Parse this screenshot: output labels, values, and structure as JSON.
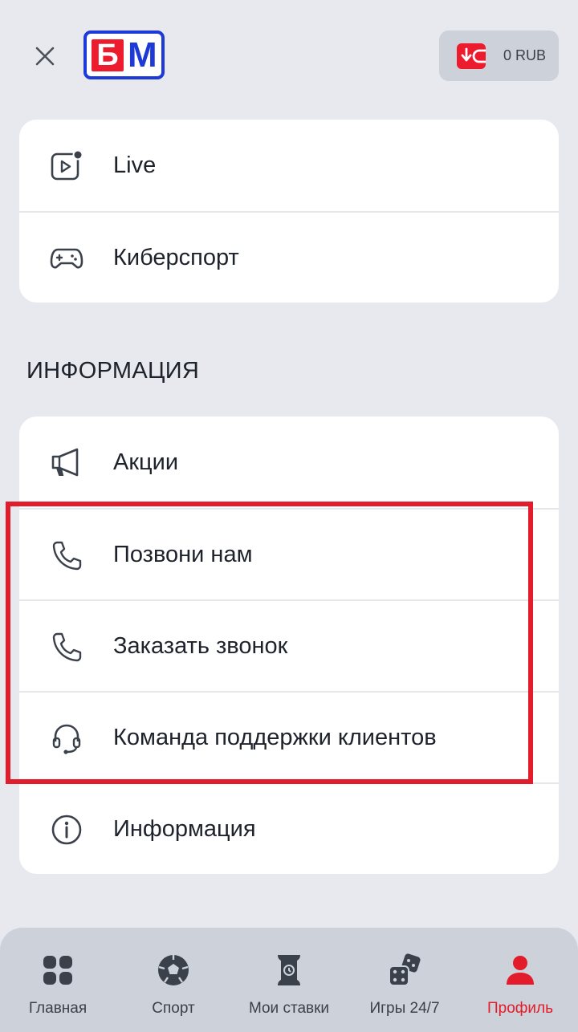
{
  "header": {
    "logo_b": "Б",
    "logo_m": "М",
    "balance": "0 RUB"
  },
  "menu_top": [
    {
      "label": "Live",
      "icon": "live-video-icon"
    },
    {
      "label": "Киберспорт",
      "icon": "gamepad-icon"
    }
  ],
  "info_section": {
    "title": "ИНФОРМАЦИЯ",
    "items": [
      {
        "label": "Акции",
        "icon": "megaphone-icon"
      },
      {
        "label": "Позвони нам",
        "icon": "phone-icon"
      },
      {
        "label": "Заказать звонок",
        "icon": "phone-icon"
      },
      {
        "label": "Команда поддержки клиентов",
        "icon": "headset-icon"
      },
      {
        "label": "Информация",
        "icon": "info-icon"
      }
    ]
  },
  "bottom_nav": [
    {
      "label": "Главная",
      "icon": "home-grid-icon"
    },
    {
      "label": "Спорт",
      "icon": "soccer-ball-icon"
    },
    {
      "label": "Мои ставки",
      "icon": "ticket-icon"
    },
    {
      "label": "Игры 24/7",
      "icon": "dice-icon"
    },
    {
      "label": "Профиль",
      "icon": "user-icon",
      "active": true
    }
  ],
  "colors": {
    "accent": "#e21c2a",
    "logo_blue": "#1d3ad6",
    "background": "#e7e9ee",
    "nav_background": "#cdd1d9"
  }
}
